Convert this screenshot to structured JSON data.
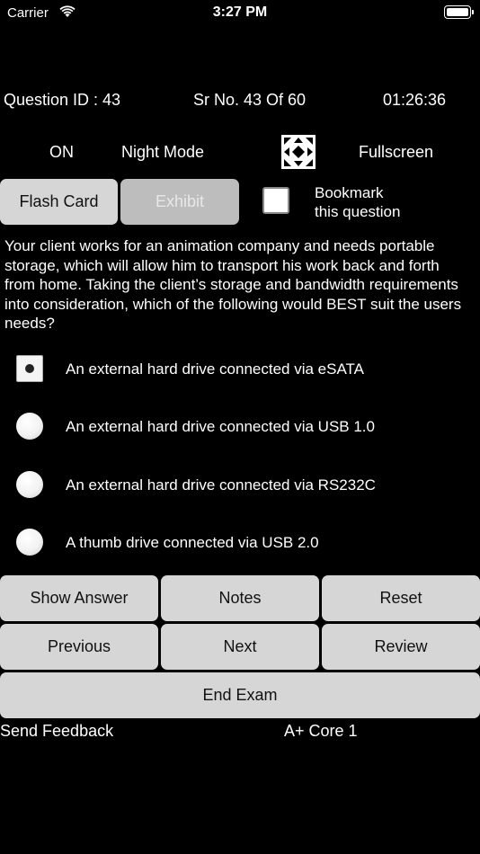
{
  "status_bar": {
    "carrier": "Carrier",
    "time": "3:27 PM"
  },
  "header": {
    "question_id": "Question ID : 43",
    "serial": "Sr No. 43 Of 60",
    "timer": "01:26:36"
  },
  "mode": {
    "night_state": "ON",
    "night_label": "Night Mode",
    "fullscreen_label": "Fullscreen"
  },
  "actions": {
    "flash_card": "Flash Card",
    "exhibit": "Exhibit",
    "bookmark_line1": "Bookmark",
    "bookmark_line2": "this question"
  },
  "question": {
    "text": "Your client works for an animation company and needs portable storage, which will allow him to transport his work back and forth from home. Taking the client’s storage and bandwidth requirements into consideration, which of the following would BEST suit the users needs?",
    "options": [
      {
        "label": "An external hard drive connected via eSATA",
        "selected": true
      },
      {
        "label": "An external hard drive connected via USB 1.0",
        "selected": false
      },
      {
        "label": "An external hard drive connected via RS232C",
        "selected": false
      },
      {
        "label": "A thumb drive connected via USB 2.0",
        "selected": false
      }
    ]
  },
  "controls": {
    "show_answer": "Show Answer",
    "notes": "Notes",
    "reset": "Reset",
    "previous": "Previous",
    "next": "Next",
    "review": "Review",
    "end_exam": "End Exam"
  },
  "footer": {
    "send_feedback": "Send Feedback",
    "exam_name": "A+ Core 1"
  }
}
